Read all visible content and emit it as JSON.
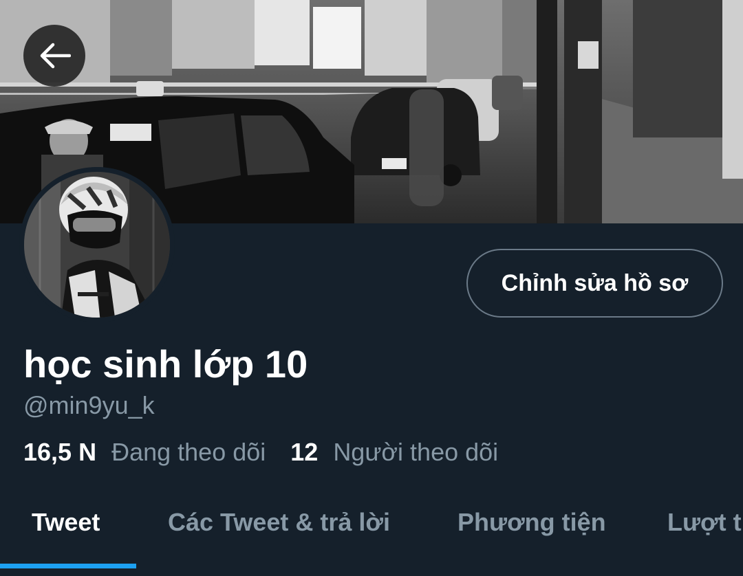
{
  "header": {
    "back_icon": "arrow-left-icon"
  },
  "profile": {
    "edit_button_label": "Chỉnh sửa hồ sơ",
    "display_name": "học sinh lớp 10",
    "handle": "@min9yu_k"
  },
  "stats": {
    "following_count": "16,5 N",
    "following_label": "Đang theo dõi",
    "followers_count": "12",
    "followers_label": "Người theo dõi"
  },
  "tabs": [
    {
      "label": "Tweet",
      "active": true
    },
    {
      "label": "Các Tweet & trả lời",
      "active": false
    },
    {
      "label": "Phương tiện",
      "active": false
    },
    {
      "label": "Lượt thích",
      "active": false
    }
  ],
  "colors": {
    "background": "#15202b",
    "accent": "#1da1f2",
    "secondary_text": "#8899a6",
    "border": "#6b7a88"
  }
}
